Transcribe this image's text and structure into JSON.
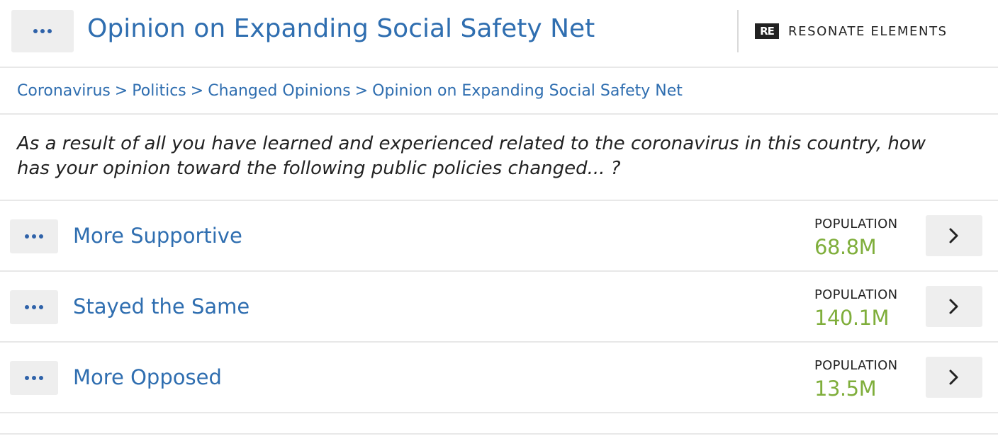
{
  "header": {
    "title": "Opinion on Expanding Social Safety Net",
    "brand_mark": "RE",
    "brand_name": "RESONATE ELEMENTS",
    "menu_icon": "ellipsis-icon"
  },
  "breadcrumb": {
    "items": [
      "Coronavirus",
      "Politics",
      "Changed Opinions",
      "Opinion on Expanding Social Safety Net"
    ],
    "separator": ">"
  },
  "question": "As a result of all you have learned and experienced related to the coronavirus in this country, how has your opinion toward the following public policies changed... ?",
  "colors": {
    "link": "#2f6eb0",
    "population_value": "#7fae3b",
    "button_bg": "#eeeeee"
  },
  "rows": [
    {
      "label": "More Supportive",
      "population_label": "POPULATION",
      "population_value": "68.8M",
      "arrow_icon": "chevron-right-icon"
    },
    {
      "label": "Stayed the Same",
      "population_label": "POPULATION",
      "population_value": "140.1M",
      "arrow_icon": "chevron-right-icon"
    },
    {
      "label": "More Opposed",
      "population_label": "POPULATION",
      "population_value": "13.5M",
      "arrow_icon": "chevron-right-icon"
    }
  ]
}
